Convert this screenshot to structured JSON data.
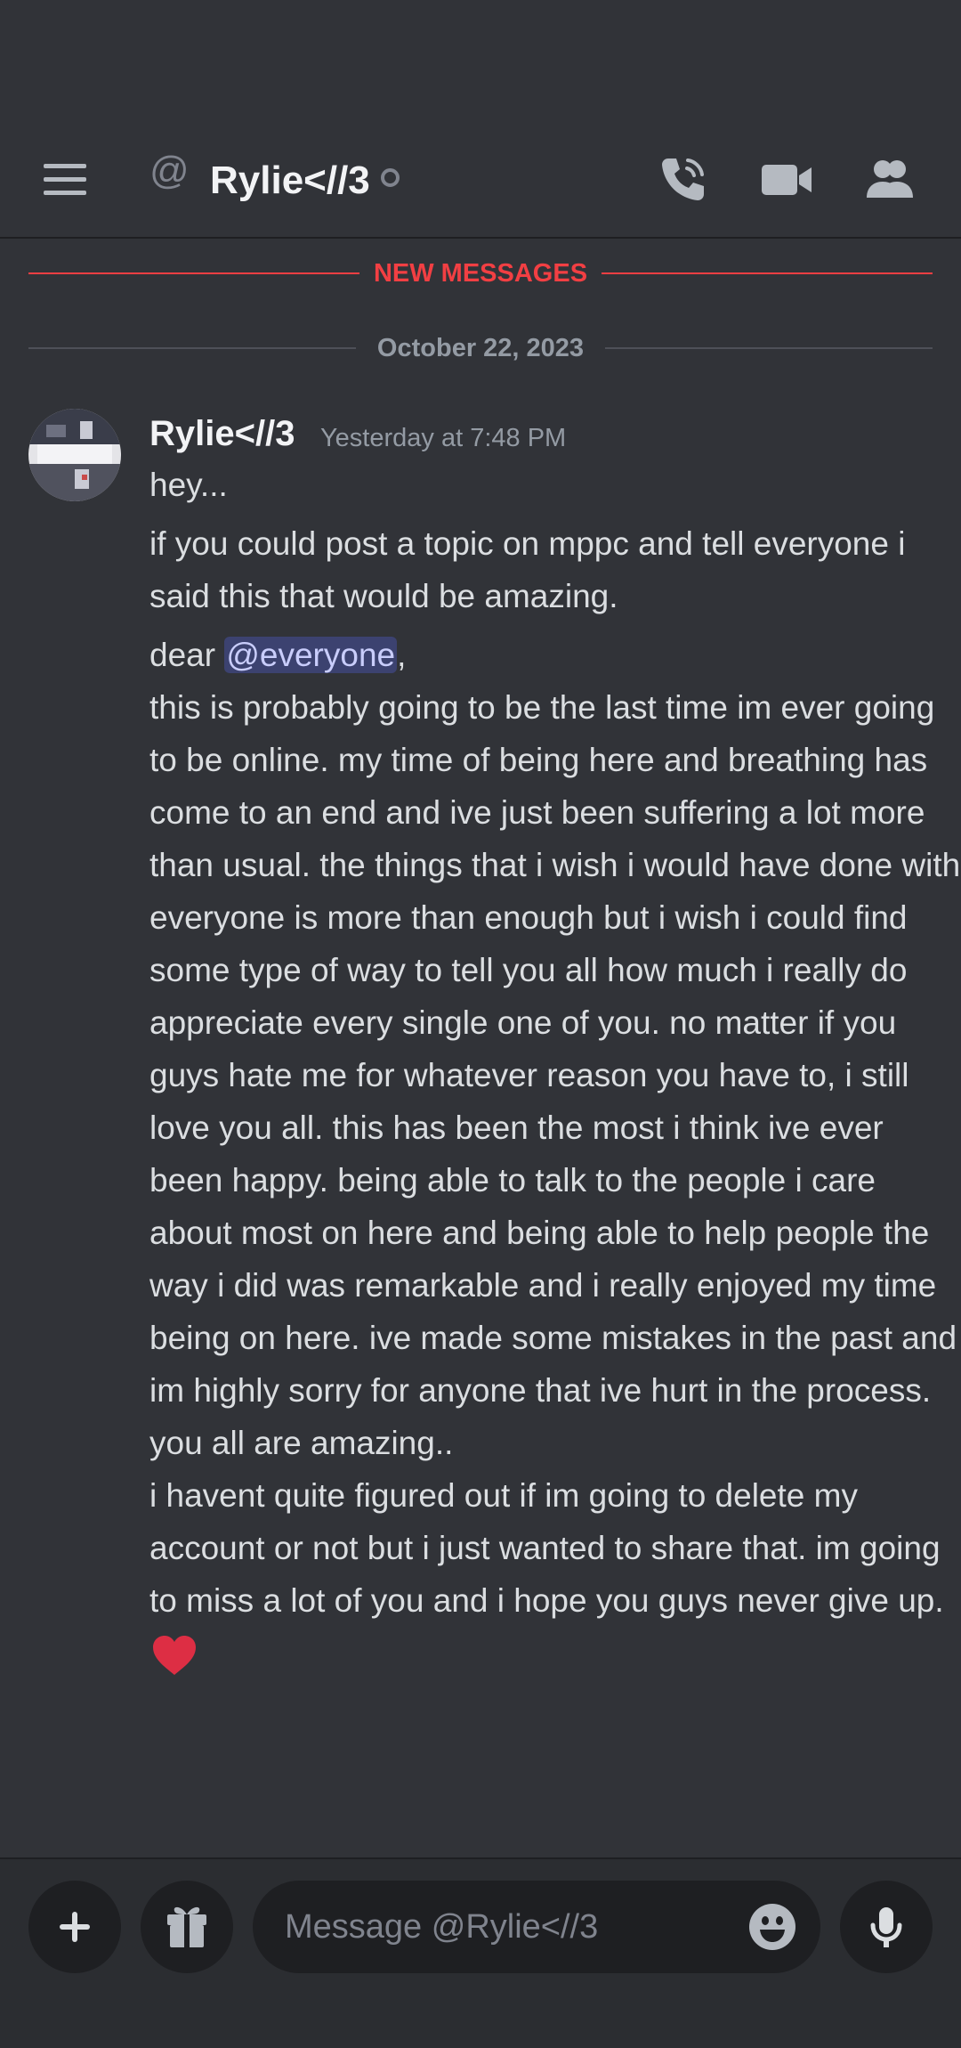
{
  "header": {
    "at_symbol": "@",
    "title": "Rylie<//3"
  },
  "dividers": {
    "new_messages": "NEW MESSAGES",
    "date": "October 22, 2023"
  },
  "message": {
    "author": "Rylie<//3",
    "timestamp": "Yesterday at 7:48 PM",
    "line1": "hey...",
    "line2": "if you could post a topic on mppc and tell everyone i said this that would be amazing.",
    "dear_prefix": "dear ",
    "mention": "@everyone",
    "dear_suffix": ",",
    "body_main": "this is probably going to be the last time im ever going to be online. my time of being here and breathing has come to an end and ive just been suffering a lot more than usual. the things that i wish i would have done with everyone is more than enough but i wish i could find some type of way to tell you all how much i really do appreciate every single one of you. no matter if you guys hate me for whatever reason you have to, i still love you all. this has been the most i think ive ever been happy. being able to talk to the people i care about most on here and being able to help people the way i did was remarkable and i really enjoyed my time being on here. ive made some mistakes in the past and im highly sorry for anyone that ive hurt in the process. you all are amazing..",
    "body_final": "i havent quite figured out if im going to delete my account or not but i just wanted to share that. im going to miss a lot of you and i hope you guys never give up."
  },
  "composer": {
    "placeholder": "Message @Rylie<//3"
  },
  "icons": {
    "menu": "hamburger-menu-icon",
    "at": "at-sign-icon",
    "status": "offline-status-dot",
    "call": "phone-call-icon",
    "video": "video-camera-icon",
    "members": "members-icon",
    "plus": "plus-icon",
    "gift": "gift-icon",
    "emoji": "emoji-icon",
    "mic": "microphone-icon",
    "heart": "red-heart-emoji"
  },
  "colors": {
    "background": "#313338",
    "new_messages": "#f23f43",
    "mention_bg": "#3c4270",
    "mention_text": "#c9cdfb",
    "composer_bg": "#2b2d31",
    "input_bg": "#1e1f22"
  }
}
